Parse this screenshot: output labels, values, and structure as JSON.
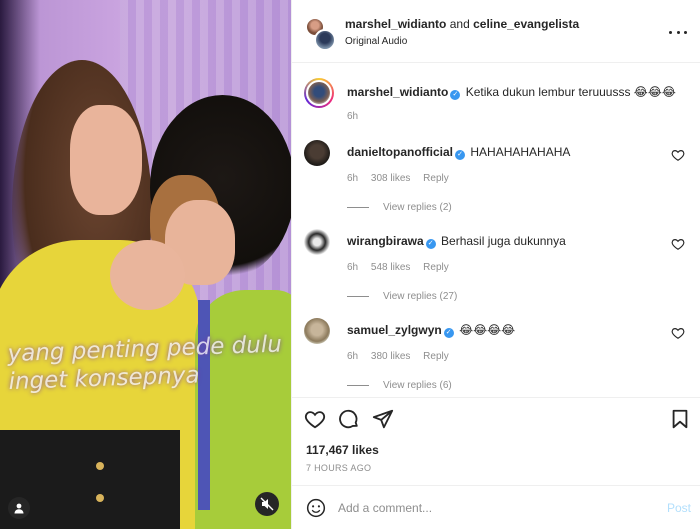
{
  "header": {
    "user1": "marshel_widianto",
    "connector": "and",
    "user2": "celine_evangelista",
    "audio": "Original Audio"
  },
  "caption": {
    "user": "marshel_widianto",
    "text": "Ketika dukun lembur teruuusss 😂😂😂",
    "time": "6h"
  },
  "video_overlay_text": "yang penting pede dulu inget konsepnya",
  "comments": [
    {
      "user": "danieltopanofficial",
      "text": "HAHAHAHAHAHA",
      "time": "6h",
      "likes": "308 likes",
      "reply": "Reply",
      "view_replies": "View replies (2)"
    },
    {
      "user": "wirangbirawa",
      "text": "Berhasil juga dukunnya",
      "time": "6h",
      "likes": "548 likes",
      "reply": "Reply",
      "view_replies": "View replies (27)"
    },
    {
      "user": "samuel_zylgwyn",
      "text": "😂😂😂😂",
      "time": "6h",
      "likes": "380 likes",
      "reply": "Reply",
      "view_replies": "View replies (6)"
    }
  ],
  "post": {
    "likes": "117,467 likes",
    "ago": "7 HOURS AGO"
  },
  "comment_box": {
    "placeholder": "Add a comment...",
    "post_label": "Post"
  },
  "colors": {
    "verified": "#3897f0",
    "muted": "#8e8e8e",
    "post_disabled": "#b2dffc"
  }
}
